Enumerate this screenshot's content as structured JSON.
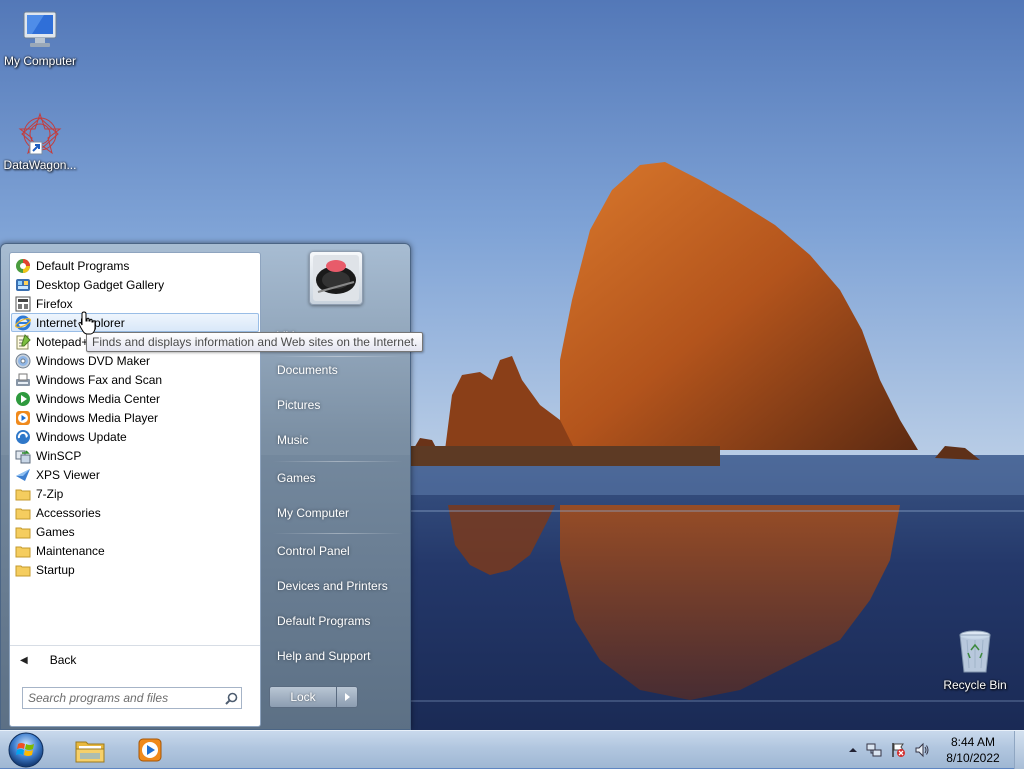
{
  "desktop": {
    "icons": [
      {
        "label": "My Computer"
      },
      {
        "label": "DataWagon..."
      },
      {
        "label": "Recycle Bin"
      }
    ]
  },
  "start_menu": {
    "programs": [
      {
        "label": "Default Programs",
        "icon": "default-programs-icon"
      },
      {
        "label": "Desktop Gadget Gallery",
        "icon": "gadget-gallery-icon"
      },
      {
        "label": "Firefox",
        "icon": "firefox-icon"
      },
      {
        "label": "Internet Explorer",
        "icon": "internet-explorer-icon"
      },
      {
        "label": "Notepad++",
        "icon": "notepad-icon"
      },
      {
        "label": "Windows DVD Maker",
        "icon": "dvd-maker-icon"
      },
      {
        "label": "Windows Fax and Scan",
        "icon": "fax-scan-icon"
      },
      {
        "label": "Windows Media Center",
        "icon": "media-center-icon"
      },
      {
        "label": "Windows Media Player",
        "icon": "media-player-icon"
      },
      {
        "label": "Windows Update",
        "icon": "windows-update-icon"
      },
      {
        "label": "WinSCP",
        "icon": "winscp-icon"
      },
      {
        "label": "XPS Viewer",
        "icon": "xps-viewer-icon"
      },
      {
        "label": "7-Zip",
        "icon": "folder-icon"
      },
      {
        "label": "Accessories",
        "icon": "folder-icon"
      },
      {
        "label": "Games",
        "icon": "folder-icon"
      },
      {
        "label": "Maintenance",
        "icon": "folder-icon"
      },
      {
        "label": "Startup",
        "icon": "folder-icon"
      }
    ],
    "back_label": "Back",
    "search_placeholder": "Search programs and files",
    "right_links": [
      {
        "label": "VM",
        "name": "user-folder"
      },
      {
        "label": "Documents",
        "name": "documents"
      },
      {
        "label": "Pictures",
        "name": "pictures"
      },
      {
        "label": "Music",
        "name": "music"
      },
      {
        "label": "Games",
        "name": "games"
      },
      {
        "label": "My Computer",
        "name": "my-computer"
      },
      {
        "label": "Control Panel",
        "name": "control-panel"
      },
      {
        "label": "Devices and Printers",
        "name": "devices-printers"
      },
      {
        "label": "Default Programs",
        "name": "default-programs"
      },
      {
        "label": "Help and Support",
        "name": "help-support"
      }
    ],
    "lock_label": "Lock",
    "tooltip": "Finds and displays information and Web sites on the Internet."
  },
  "taskbar": {
    "clock_time": "8:44 AM",
    "clock_date": "8/10/2022"
  },
  "colors": {
    "sky": "#5f86c2",
    "rock": "#b5531c",
    "water": "#23386a",
    "hover_highlight": "#d9e8f9"
  }
}
